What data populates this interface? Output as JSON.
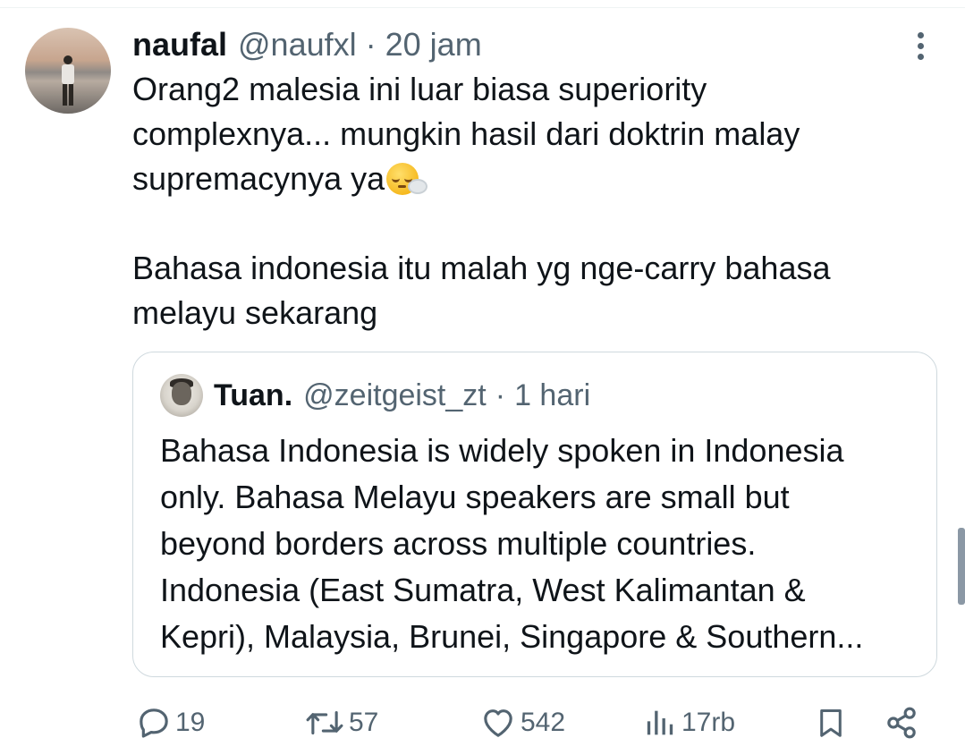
{
  "tweet": {
    "author_name": "naufal",
    "author_handle": "@naufxl",
    "separator": "·",
    "time": "20 jam",
    "lines": [
      "Orang2 malesia ini luar biasa superiority",
      "complexnya... mungkin hasil dari doktrin malay",
      "supremacynya ya"
    ],
    "paragraph2": [
      "Bahasa indonesia itu malah yg nge-carry bahasa",
      "melayu sekarang"
    ]
  },
  "quoted_tweet": {
    "author_name": "Tuan.",
    "author_handle": "@zeitgeist_zt",
    "separator": "·",
    "time": "1 hari",
    "lines": [
      "Bahasa Indonesia is widely spoken in Indonesia",
      "only. Bahasa Melayu speakers are small but",
      "beyond borders across multiple countries.",
      "Indonesia (East Sumatra, West Kalimantan &",
      "Kepri), Malaysia, Brunei, Singapore & Southern..."
    ]
  },
  "actions": {
    "reply_count": "19",
    "retweet_count": "57",
    "like_count": "542",
    "views_count": "17rb"
  },
  "icons": {
    "more": "more-vertical-icon",
    "reply": "reply-icon",
    "retweet": "retweet-icon",
    "like": "heart-icon",
    "views": "views-icon",
    "bookmark": "bookmark-icon",
    "share": "share-icon",
    "emoji": "sleepy-face-emoji"
  },
  "colors": {
    "text_primary": "#0f1419",
    "text_secondary": "#536471",
    "border": "#cfd9de"
  }
}
